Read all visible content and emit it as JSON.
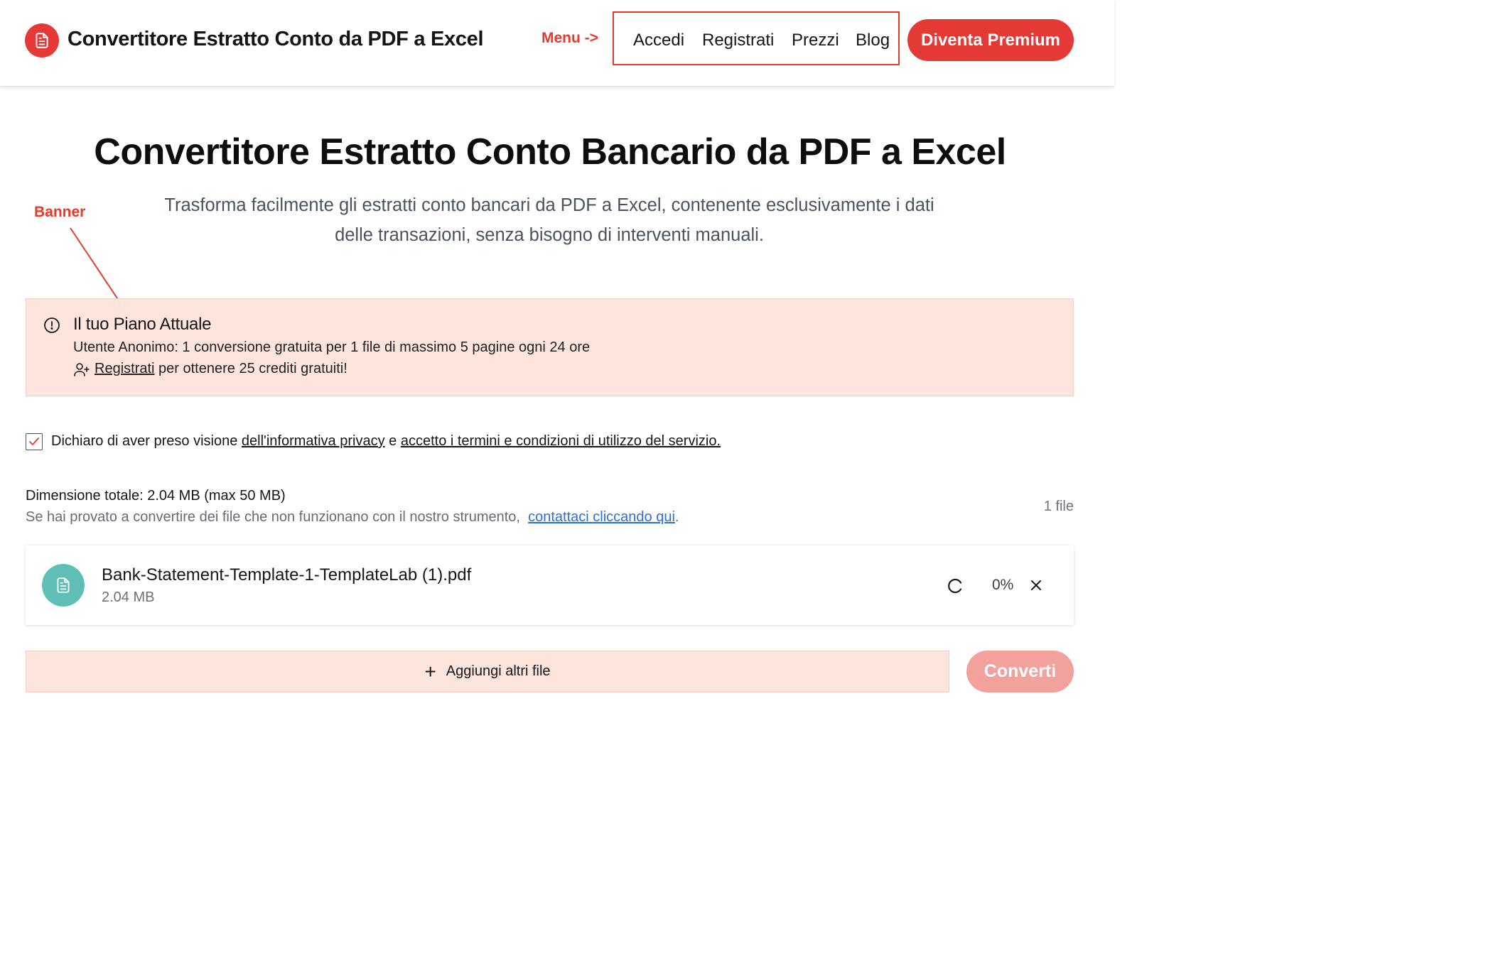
{
  "header": {
    "brand_title": "Convertitore Estratto Conto da PDF a Excel",
    "logo_icon": "document-icon",
    "menu_annotation": "Menu ->",
    "nav": [
      {
        "label": "Accedi"
      },
      {
        "label": "Registrati"
      },
      {
        "label": "Prezzi"
      },
      {
        "label": "Blog"
      }
    ],
    "premium_label": "Diventa Premium"
  },
  "hero": {
    "title": "Convertitore Estratto Conto Bancario da PDF a Excel",
    "subtitle_line1": "Trasforma facilmente gli estratti conto bancari da PDF a Excel, contenente esclusivamente i dati",
    "subtitle_line2": "delle transazioni, senza bisogno di interventi manuali."
  },
  "banner_annotation": "Banner",
  "plan": {
    "title": "Il tuo Piano Attuale",
    "description": "Utente Anonimo: 1 conversione gratuita per 1 file di massimo 5 pagine ogni 24 ore",
    "register_link": "Registrati",
    "register_suffix": " per ottenere 25 crediti gratuiti!"
  },
  "consent": {
    "checked": true,
    "prefix": "Dichiaro di aver preso visione ",
    "privacy_link": "dell'informativa privacy",
    "middle": " e ",
    "terms_link": "accetto i termini e condizioni di utilizzo del servizio."
  },
  "files": {
    "total_size": "Dimensione totale: 2.04 MB (max 50 MB)",
    "help_prefix": "Se hai provato a convertire dei file che non funzionano con il nostro strumento,  ",
    "help_link": "contattaci cliccando qui",
    "help_suffix": ".",
    "count": "1 file",
    "items": [
      {
        "name": "Bank-Statement-Template-1-TemplateLab (1).pdf",
        "size": "2.04 MB",
        "progress": "0%"
      }
    ]
  },
  "actions": {
    "add_files": "Aggiungi altri file",
    "convert": "Converti"
  },
  "colors": {
    "accent": "#e53935",
    "banner_bg": "#fde4dd",
    "annotation": "#e83a2b",
    "file_icon_bg": "#5fbfb6",
    "link": "#2d6fd6",
    "convert_disabled": "#f2a19c"
  }
}
